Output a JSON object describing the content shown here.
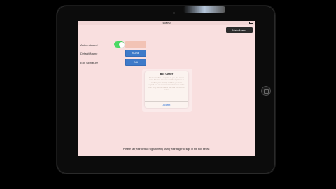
{
  "status_bar": {
    "carrier": "",
    "time": "3:38 PM"
  },
  "header": {
    "main_menu_label": "Main Menu"
  },
  "settings": {
    "authenticated_label": "Authenticated",
    "default_name_label": "Default Name",
    "edit_signature_label": "Edit Signature",
    "name_button_label": "NONE",
    "edit_button_label": "Edit"
  },
  "alert": {
    "title": "Box Owner",
    "message": "Please confirm it appears to you, the signer owns this box. You can use the signature to confirm your identity and that you have signed and are the responsible owner of this box. Only the box owner can use this box for review.",
    "accept_label": "Accept"
  },
  "footer": {
    "instruction": "Please set your default signature by using your finger to sign in the box below."
  },
  "colors": {
    "screen_background": "#f9dfdf",
    "toggle_on": "#4cd964",
    "button_blue": "#3e7ac9",
    "accept_link": "#2a6fd6"
  }
}
